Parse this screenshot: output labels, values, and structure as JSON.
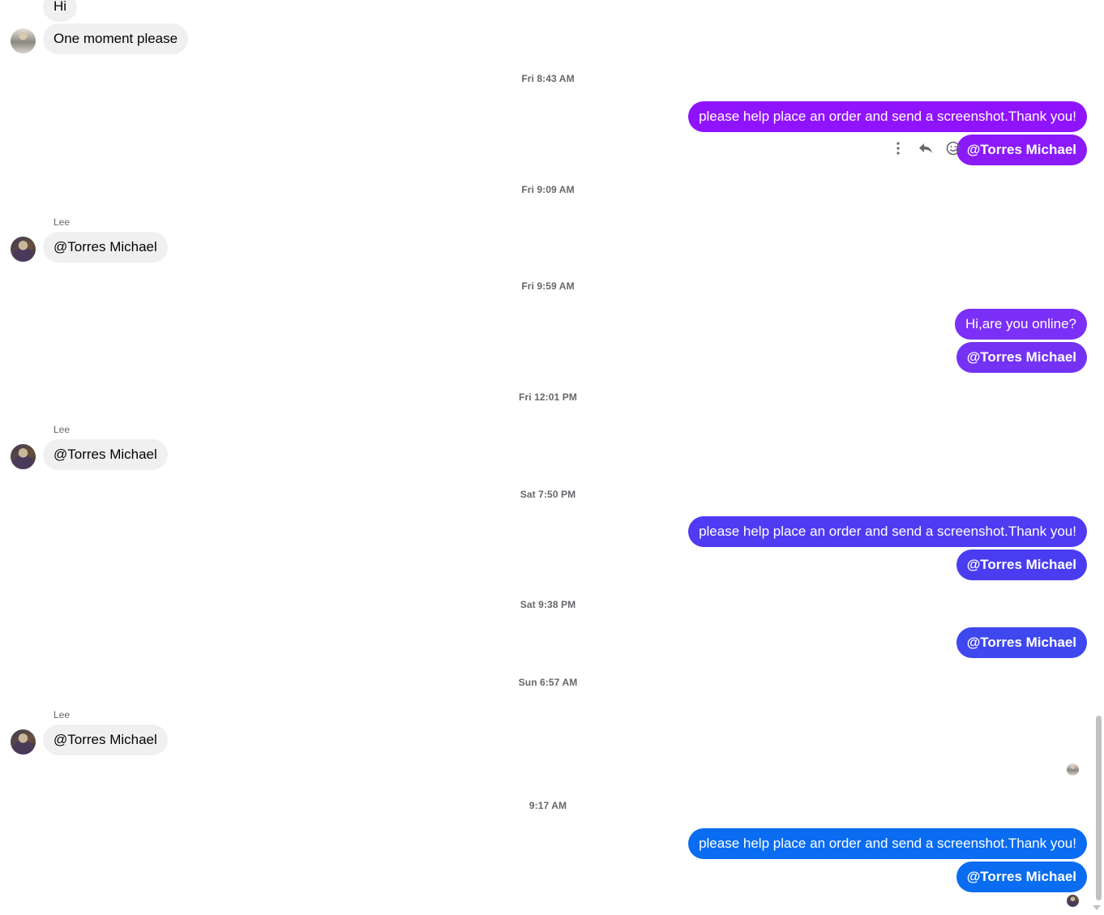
{
  "messages": {
    "hi": "Hi",
    "one_moment": "One moment please",
    "order_request": "please help place an order and send a screenshot.Thank you!",
    "mention": "@Torres Michael",
    "online_check": "Hi,are you online?"
  },
  "senders": {
    "lee": "Lee"
  },
  "timestamps": {
    "t1": "Fri 8:43 AM",
    "t2": "Fri 9:09 AM",
    "t3": "Fri 9:59 AM",
    "t4": "Fri 12:01 PM",
    "t5": "Sat 7:50 PM",
    "t6": "Sat 9:38 PM",
    "t7": "Sun 6:57 AM",
    "t8": "9:17 AM"
  },
  "icons": {
    "more": "more-vertical-icon",
    "reply": "reply-icon",
    "react": "emoji-icon"
  },
  "colors": {
    "incoming_bubble": "#f0f0f0",
    "outgoing_purple": "#9013fe",
    "outgoing_violet": "#7b2ff7",
    "outgoing_indigo": "#4f3bf2",
    "outgoing_blue_violet": "#3f48ee",
    "outgoing_blue": "#0a6cf0",
    "timestamp_text": "#65676b"
  }
}
